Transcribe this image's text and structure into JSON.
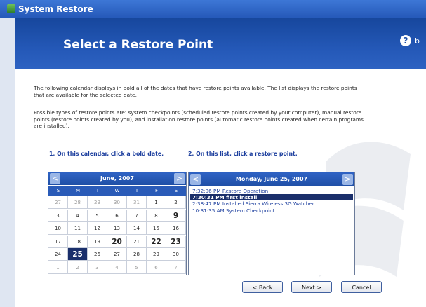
{
  "window": {
    "title": "System Restore"
  },
  "header": {
    "title": "Select a Restore Point",
    "help_icon": "?",
    "help_label": "b"
  },
  "description": {
    "para1": "The following calendar displays in bold all of the dates that have restore points available. The list displays the restore points that are available for the selected date.",
    "para2": "Possible types of restore points are: system checkpoints (scheduled restore points created by your computer), manual restore points (restore points created by you), and installation restore points (automatic restore points created when certain programs are installed)."
  },
  "steps": {
    "step1": "1. On this calendar, click a bold date.",
    "step2": "2. On this list, click a restore point."
  },
  "calendar": {
    "month_label": "June, 2007",
    "prev": "<",
    "next": ">",
    "weekdays": [
      "S",
      "M",
      "T",
      "W",
      "T",
      "F",
      "S"
    ],
    "weeks": [
      [
        {
          "d": "27",
          "o": true
        },
        {
          "d": "28",
          "o": true
        },
        {
          "d": "29",
          "o": true
        },
        {
          "d": "30",
          "o": true
        },
        {
          "d": "31",
          "o": true
        },
        {
          "d": "1"
        },
        {
          "d": "2"
        }
      ],
      [
        {
          "d": "3"
        },
        {
          "d": "4"
        },
        {
          "d": "5"
        },
        {
          "d": "6"
        },
        {
          "d": "7"
        },
        {
          "d": "8"
        },
        {
          "d": "9",
          "b": true
        }
      ],
      [
        {
          "d": "10"
        },
        {
          "d": "11"
        },
        {
          "d": "12"
        },
        {
          "d": "13"
        },
        {
          "d": "14"
        },
        {
          "d": "15"
        },
        {
          "d": "16"
        }
      ],
      [
        {
          "d": "17"
        },
        {
          "d": "18"
        },
        {
          "d": "19"
        },
        {
          "d": "20",
          "b": true
        },
        {
          "d": "21"
        },
        {
          "d": "22",
          "b": true
        },
        {
          "d": "23",
          "b": true
        }
      ],
      [
        {
          "d": "24"
        },
        {
          "d": "25",
          "s": true
        },
        {
          "d": "26"
        },
        {
          "d": "27"
        },
        {
          "d": "28"
        },
        {
          "d": "29"
        },
        {
          "d": "30"
        }
      ],
      [
        {
          "d": "1",
          "o": true
        },
        {
          "d": "2",
          "o": true
        },
        {
          "d": "3",
          "o": true
        },
        {
          "d": "4",
          "o": true
        },
        {
          "d": "5",
          "o": true
        },
        {
          "d": "6",
          "o": true
        },
        {
          "d": "7",
          "o": true
        }
      ]
    ]
  },
  "restore_list": {
    "date_label": "Monday, June 25, 2007",
    "prev": "<",
    "next": ">",
    "items": [
      {
        "label": "7:32:06 PM  Restore Operation",
        "selected": false
      },
      {
        "label": "7:30:31 PM  first install",
        "selected": true
      },
      {
        "label": "2:38:47 PM  Installed Sierra Wireless 3G Watcher",
        "selected": false
      },
      {
        "label": "10:31:35 AM  System Checkpoint",
        "selected": false
      }
    ]
  },
  "buttons": {
    "back": "< Back",
    "next": "Next >",
    "cancel": "Cancel"
  }
}
